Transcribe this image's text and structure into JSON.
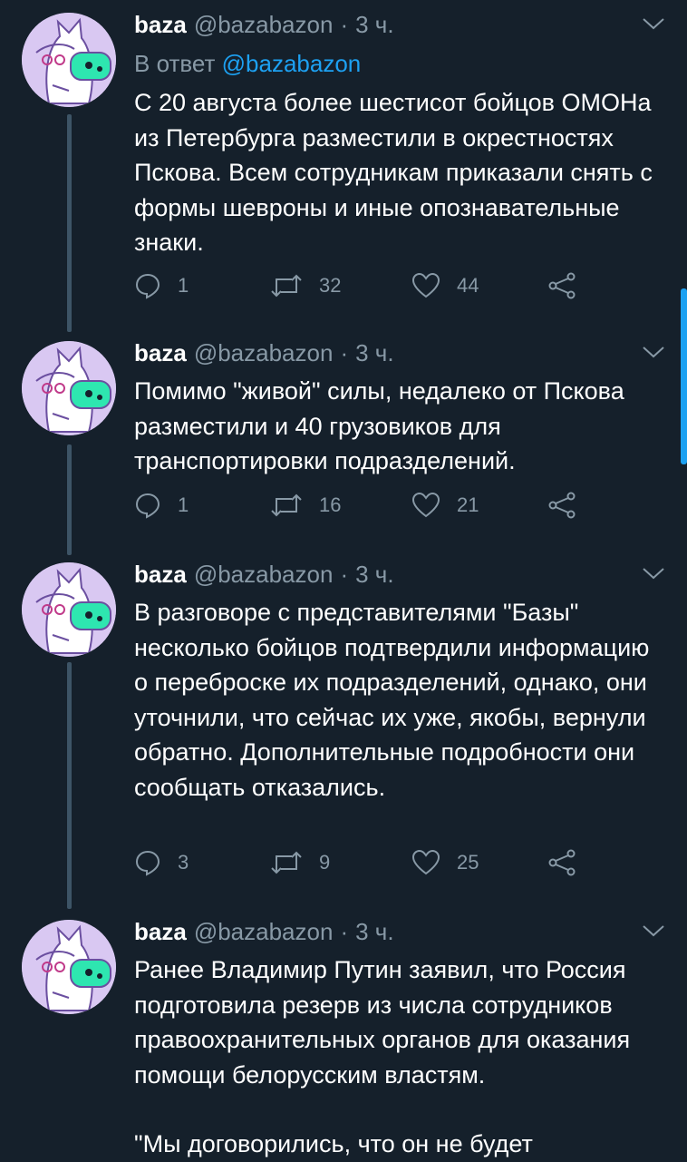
{
  "tweets": [
    {
      "author_name": "baza",
      "author_handle": "@bazabazon",
      "separator": "·",
      "time": "3 ч.",
      "reply_prefix": "В ответ",
      "reply_mention": "@bazabazon",
      "text": "С 20 августа более шестисот бойцов ОМОНа из Петербурга разместили в окрестностях Пскова. Всем сотрудникам приказали снять с формы шевроны и иные опознавательные знаки.",
      "replies": "1",
      "retweets": "32",
      "likes": "44"
    },
    {
      "author_name": "baza",
      "author_handle": "@bazabazon",
      "separator": "·",
      "time": "3 ч.",
      "text": "Помимо \"живой\" силы, недалеко от Пскова разместили и 40 грузовиков для транспортировки подразделений.",
      "replies": "1",
      "retweets": "16",
      "likes": "21"
    },
    {
      "author_name": "baza",
      "author_handle": "@bazabazon",
      "separator": "·",
      "time": "3 ч.",
      "text": "В разговоре с представителями \"Базы\" несколько бойцов подтвердили информацию о переброске их подразделений, однако, они уточнили, что сейчас их уже, якобы, вернули обратно. Дополнительные подробности они сообщать отказались.",
      "replies": "3",
      "retweets": "9",
      "likes": "25"
    },
    {
      "author_name": "baza",
      "author_handle": "@bazabazon",
      "separator": "·",
      "time": "3 ч.",
      "text": "Ранее Владимир Путин заявил, что Россия подготовила резерв из числа сотрудников правоохранительных органов для оказания помощи белорусским властям.",
      "text2": "\"Мы договорились, что он не будет"
    }
  ],
  "colors": {
    "background": "#15202b",
    "secondary_text": "#8899a6",
    "link": "#1da1f2",
    "thread_line": "#3d5466",
    "avatar_bg": "#d9c8f2"
  },
  "icons": {
    "reply": "speech-bubble-icon",
    "retweet": "retweet-arrows-icon",
    "like": "heart-icon",
    "share": "share-nodes-icon",
    "menu": "chevron-down-icon"
  }
}
